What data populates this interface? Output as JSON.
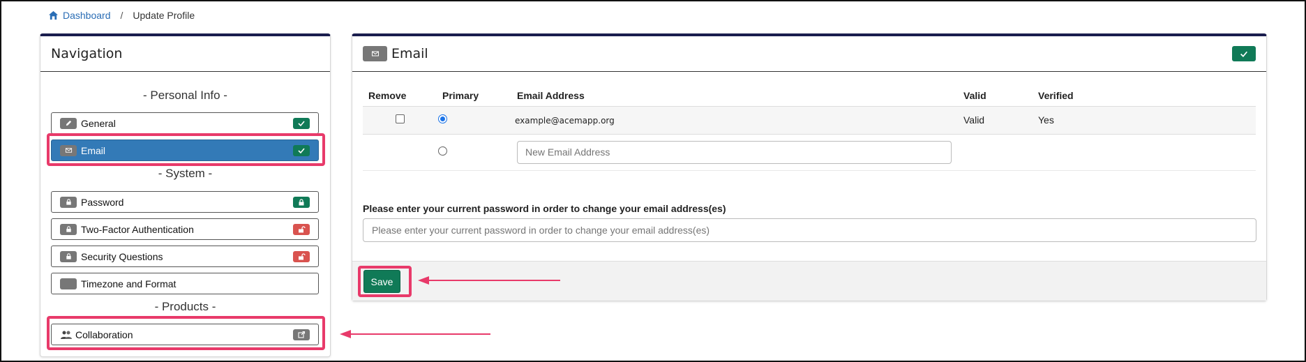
{
  "breadcrumb": {
    "home": "Dashboard",
    "separator": "/",
    "current": "Update Profile"
  },
  "navigation": {
    "title": "Navigation",
    "sections": [
      {
        "label": "- Personal Info -"
      },
      {
        "label": "- System -"
      },
      {
        "label": "- Products -"
      }
    ],
    "items": [
      {
        "label": "General",
        "icon": "pencil-icon",
        "status": "check-icon"
      },
      {
        "label": "Email",
        "icon": "envelope-icon",
        "status": "check-icon",
        "active": true
      },
      {
        "label": "Password",
        "icon": "lock-icon",
        "status": "lock-closed-icon"
      },
      {
        "label": "Two-Factor Authentication",
        "icon": "lock-icon",
        "status": "lock-open-icon"
      },
      {
        "label": "Security Questions",
        "icon": "lock-icon",
        "status": "lock-open-icon"
      },
      {
        "label": "Timezone and Format",
        "icon": "blank-icon",
        "status": ""
      },
      {
        "label": "Collaboration",
        "icon": "people-icon",
        "status": "external-link-icon"
      }
    ]
  },
  "email_panel": {
    "title": "Email",
    "columns": [
      "Remove",
      "Primary",
      "Email Address",
      "Valid",
      "Verified"
    ],
    "rows": [
      {
        "email": "example@acemapp.org",
        "valid": "Valid",
        "verified": "Yes",
        "primary": true,
        "remove": false
      }
    ],
    "new_email_placeholder": "New Email Address",
    "password_label": "Please enter your current password in order to change your email address(es)",
    "password_placeholder": "Please enter your current password in order to change your email address(es)",
    "save_label": "Save"
  },
  "colors": {
    "accent": "#337ab7",
    "success": "#107a57",
    "danger": "#d9534f",
    "highlight": "#e83a6a",
    "panel_top": "#1a1d4e"
  }
}
